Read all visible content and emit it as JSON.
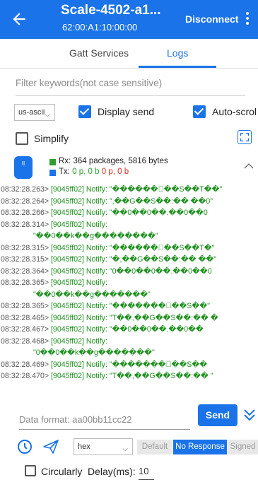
{
  "header": {
    "title": "Scale-4502-a1...",
    "subtitle": "62:00:A1:10:00:00",
    "disconnect_label": "Disconnect"
  },
  "tabs": [
    {
      "label": "Gatt Services",
      "active": false
    },
    {
      "label": "Logs",
      "active": true
    }
  ],
  "filter": {
    "placeholder": "Filter keywords(not case sensitive)"
  },
  "options": {
    "encoding": "us-ascii",
    "display_send": {
      "label": "Display send",
      "checked": true
    },
    "auto_scroll": {
      "label": "Auto-scrol",
      "checked": true
    },
    "simplify": {
      "label": "Simplify",
      "checked": false
    }
  },
  "stats": {
    "icon_text": "II",
    "rx": "Rx: 364 packages, 5816 bytes",
    "tx_prefix": "Tx: ",
    "tx_p1": "0 p, 0 b",
    "tx_sep": " ",
    "tx_p2": "0 p, 0 b",
    "rx_color": "#2e9e2e",
    "tx_color": "#1a73e8"
  },
  "log": [
    {
      "ts": "08:32:28.263>",
      "msg": " [9045ff02] Notify: \"������\u0000��S��T��\""
    },
    {
      "ts": "08:32:28.264>",
      "msg": " [9045ff02] Notify: \",��G��S��:�� ��0\""
    },
    {
      "ts": "08:32:28.266>",
      "msg": " [9045ff02] Notify: \"��0��0��.��0��0"
    },
    {
      "ts": "08:32:28.314>",
      "msg": " [9045ff02] Notify:"
    },
    {
      "ts": "",
      "msg": "\"��0��k��g��������\""
    },
    {
      "ts": "08:32:28.315>",
      "msg": " [9045ff02] Notify: \"������\u0000��S��T�\""
    },
    {
      "ts": "08:32:28.315>",
      "msg": " [9045ff02] Notify: \"�,��G��S��:�� ��\""
    },
    {
      "ts": "08:32:28.364>",
      "msg": " [9045ff02] Notify: \"0��0��0��.��0��0"
    },
    {
      "ts": "08:32:28.365>",
      "msg": " [9045ff02] Notify:"
    },
    {
      "ts": "",
      "msg": "\"��0��k��g�������\""
    },
    {
      "ts": "08:32:28.365>",
      "msg": " [9045ff02] Notify: \"�������\u0000��S��\""
    },
    {
      "ts": "08:32:28.465>",
      "msg": " [9045ff02] Notify: \"T��,��G��S��:�� �"
    },
    {
      "ts": "08:32:28.467>",
      "msg": " [9045ff02] Notify: \"��0��0��.��0��"
    },
    {
      "ts": "08:32:28.468>",
      "msg": " [9045ff02] Notify:"
    },
    {
      "ts": "",
      "msg": "\"0��0��k��g�������\""
    },
    {
      "ts": "08:32:28.469>",
      "msg": " [9045ff02] Notify: \"�������\u0000��S��"
    },
    {
      "ts": "08:32:28.470>",
      "msg": " [9045ff02] Notify: \"T��,��G��S��:�� \""
    }
  ],
  "send": {
    "placeholder": "Data format: aa00bb11cc22",
    "button_label": "Send"
  },
  "bottom": {
    "format": "hex",
    "segments": [
      "Default",
      "No Response",
      "Signed"
    ],
    "selected_segment": "No Response",
    "circularly_label": "Circularly",
    "circularly_checked": false,
    "delay_label": "Delay(ms):",
    "delay_value": "10"
  },
  "colors": {
    "accent": "#1a73e8",
    "log_message": "#1e8f1e",
    "timestamp": "#555555"
  }
}
